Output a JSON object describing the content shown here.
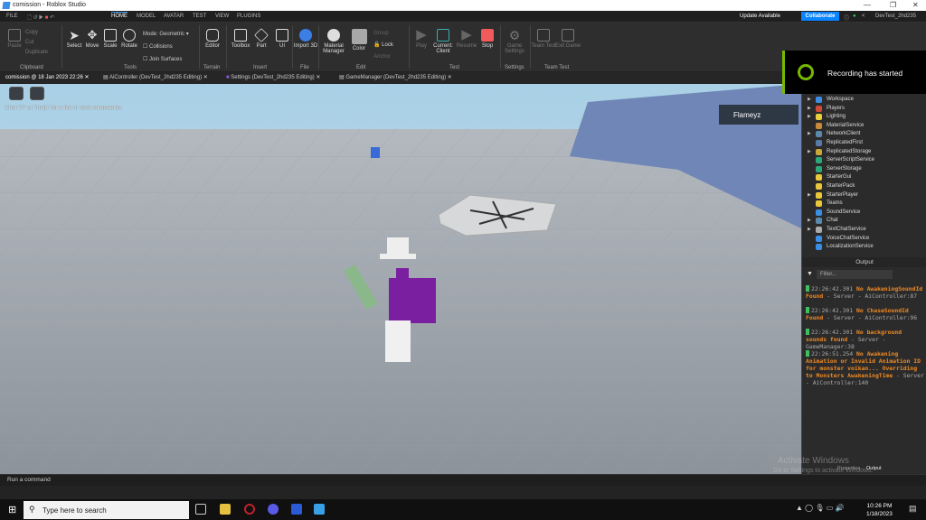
{
  "window": {
    "title": "comission - Roblox Studio"
  },
  "menu": {
    "file": "FILE",
    "tabs": [
      "HOME",
      "MODEL",
      "AVATAR",
      "TEST",
      "VIEW",
      "PLUGINS"
    ],
    "active": "HOME",
    "update": "Update Available",
    "collaborate": "Collaborate",
    "user": "DevTest_2hd235"
  },
  "ribbon": {
    "clipboard": {
      "paste": "Paste",
      "copy": "Copy",
      "cut": "Cut",
      "duplicate": "Duplicate",
      "group": "Clipboard"
    },
    "tools": {
      "select": "Select",
      "move": "Move",
      "scale": "Scale",
      "rotate": "Rotate",
      "mode_label": "Mode:",
      "mode_value": "Geometric",
      "collisions": "Collisions",
      "join": "Join Surfaces",
      "group": "Tools"
    },
    "terrain": {
      "editor": "Editor",
      "group": "Terrain"
    },
    "insert": {
      "toolbox": "Toolbox",
      "part": "Part",
      "ui": "UI",
      "group": "Insert"
    },
    "file": {
      "import": "Import 3D",
      "group": "File"
    },
    "edit": {
      "material": "Material Manager",
      "color": "Color",
      "group_btn": "Group",
      "lock": "Lock",
      "anchor": "Anchor",
      "group": "Edit"
    },
    "test": {
      "play": "Play",
      "current": "Current: Client",
      "resume": "Resume",
      "stop": "Stop",
      "group": "Test"
    },
    "settings": {
      "game": "Game Settings",
      "group": "Settings"
    },
    "teamtest": {
      "team": "Team Test",
      "exit": "Exit Game",
      "group": "Team Test"
    }
  },
  "doc_tabs": [
    "comission @ 18 Jan 2023 22:26",
    "AiController (DevTest_2hd235 Editing)",
    "Settings (DevTest_2hd235 Editing)",
    "GameManager (DevTest_2hd235 Editing)"
  ],
  "viewport": {
    "chat_hint": "Chat '/?' or '/help' for a list of chat commands.",
    "player": "Flameyz"
  },
  "recording": {
    "text": "Recording has started",
    "accent": "#76b900"
  },
  "explorer": {
    "items": [
      {
        "name": "Workspace",
        "exp": true,
        "c": "#3a8ee6"
      },
      {
        "name": "Players",
        "exp": true,
        "c": "#d04a3a"
      },
      {
        "name": "Lighting",
        "exp": true,
        "c": "#e8d03a"
      },
      {
        "name": "MaterialService",
        "exp": false,
        "c": "#c98a3a"
      },
      {
        "name": "NetworkClient",
        "exp": true,
        "c": "#5a8aaa"
      },
      {
        "name": "ReplicatedFirst",
        "exp": false,
        "c": "#5a7aaa"
      },
      {
        "name": "ReplicatedStorage",
        "exp": true,
        "c": "#c9a83a"
      },
      {
        "name": "ServerScriptService",
        "exp": false,
        "c": "#2aa87a"
      },
      {
        "name": "ServerStorage",
        "exp": false,
        "c": "#2aa87a"
      },
      {
        "name": "StarterGui",
        "exp": false,
        "c": "#e8c83a"
      },
      {
        "name": "StarterPack",
        "exp": false,
        "c": "#e8c83a"
      },
      {
        "name": "StarterPlayer",
        "exp": true,
        "c": "#e8c83a"
      },
      {
        "name": "Teams",
        "exp": false,
        "c": "#e8c83a"
      },
      {
        "name": "SoundService",
        "exp": false,
        "c": "#3a8ee6"
      },
      {
        "name": "Chat",
        "exp": true,
        "c": "#5a8aaa"
      },
      {
        "name": "TextChatService",
        "exp": true,
        "c": "#aaaaaa"
      },
      {
        "name": "VoiceChatService",
        "exp": false,
        "c": "#3a8ee6"
      },
      {
        "name": "LocalizationService",
        "exp": false,
        "c": "#3a8ee6"
      }
    ]
  },
  "output": {
    "title": "Output",
    "filter": "Filter...",
    "logs": [
      {
        "time": "22:26:42.301",
        "msg": "No AwakeningSoundId Found",
        "src": " - Server - AiController:87"
      },
      {
        "time": "22:26:42.301",
        "msg": "No ChaseSoundId Found",
        "src": " - Server - AiController:96"
      },
      {
        "time": "22:26:42.301",
        "msg": "No background sounds found",
        "src": " - Server - GameManager:38"
      },
      {
        "time": "22:26:51.254",
        "msg": "No Awakening Animation or Invalid Animation ID for monster voikan... Overriding to Monsters AwakeningTime",
        "src": " - Server - AiController:140"
      }
    ],
    "tabs": [
      "Properties",
      "Output"
    ]
  },
  "command": {
    "placeholder": "Run a command"
  },
  "watermark": {
    "l1": "Activate Windows",
    "l2": "Go to Settings to activate Windows."
  },
  "taskbar": {
    "search": "Type here to search",
    "time": "10:26 PM",
    "date": "1/18/2023"
  }
}
